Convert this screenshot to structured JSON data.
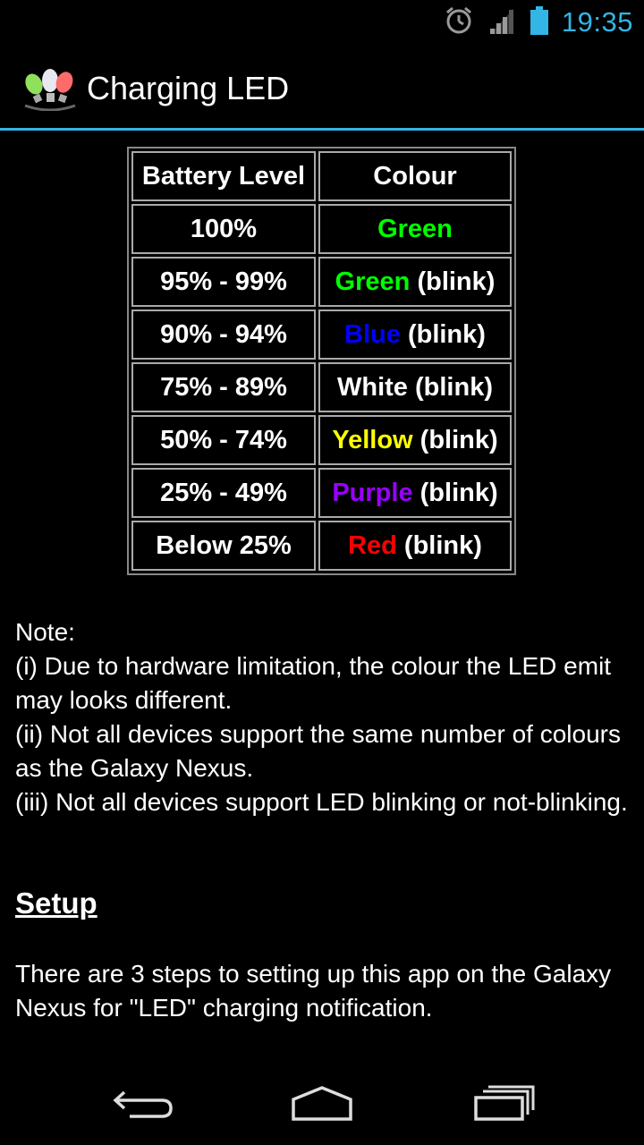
{
  "status_bar": {
    "time": "19:35",
    "icons": [
      "alarm-icon",
      "signal-icon",
      "battery-icon"
    ],
    "accent_color": "#33b5e5"
  },
  "action_bar": {
    "title": "Charging LED",
    "icon": "led-bulbs-icon"
  },
  "table": {
    "headers": [
      "Battery Level",
      "Colour"
    ],
    "rows": [
      {
        "level": "100%",
        "colour": "Green",
        "colour_hex": "#00ff00",
        "suffix": ""
      },
      {
        "level": "95% - 99%",
        "colour": "Green",
        "colour_hex": "#00ff00",
        "suffix": " (blink)"
      },
      {
        "level": "90% - 94%",
        "colour": "Blue",
        "colour_hex": "#0000ff",
        "suffix": " (blink)"
      },
      {
        "level": "75% - 89%",
        "colour": "White",
        "colour_hex": "#ffffff",
        "suffix": " (blink)"
      },
      {
        "level": "50% - 74%",
        "colour": "Yellow",
        "colour_hex": "#ffff00",
        "suffix": " (blink)"
      },
      {
        "level": "25% - 49%",
        "colour": "Purple",
        "colour_hex": "#9900ff",
        "suffix": " (blink)"
      },
      {
        "level": "Below 25%",
        "colour": "Red",
        "colour_hex": "#ff0000",
        "suffix": " (blink)"
      }
    ]
  },
  "note": {
    "heading": "Note:",
    "lines": [
      "(i) Due to hardware limitation, the colour the LED emit may looks different.",
      "(ii) Not all devices support the same number of colours as the Galaxy Nexus.",
      "(iii) Not all devices support LED blinking or not-blinking."
    ]
  },
  "setup": {
    "heading": "Setup",
    "text": "There are 3 steps to setting up this app on the Galaxy Nexus for \"LED\" charging notification."
  },
  "nav_bar": {
    "buttons": [
      "back-icon",
      "home-icon",
      "recent-apps-icon"
    ]
  }
}
